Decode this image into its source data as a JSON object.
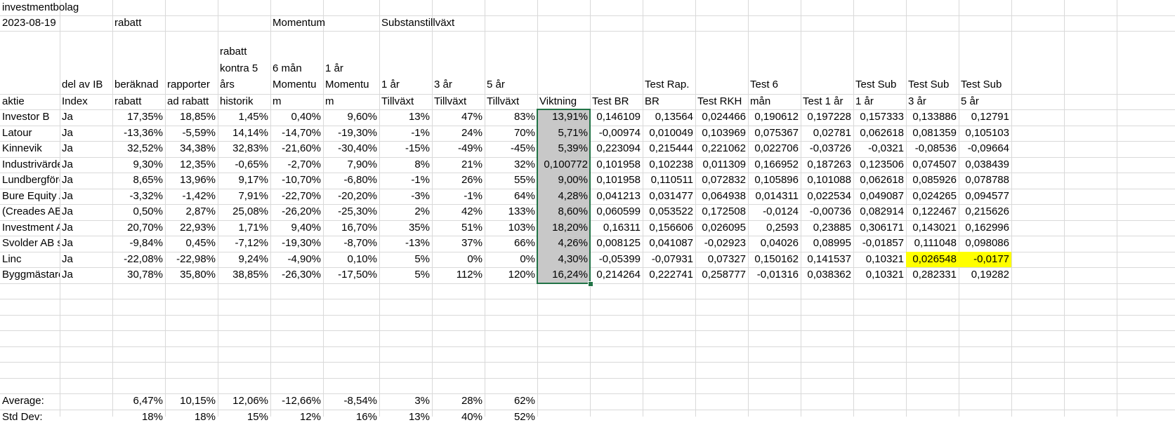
{
  "sheet": {
    "title": "investmentbolag",
    "date": "2023-08-19",
    "groups": [
      "rabatt",
      "Momentum",
      "Substanstillväxt"
    ],
    "headers": [
      [
        "aktie"
      ],
      [
        "del av IB",
        "Index"
      ],
      [
        "beräknad",
        "rabatt"
      ],
      [
        "rapporter",
        "ad rabatt"
      ],
      [
        "rabatt",
        "kontra 5",
        "års",
        "historik"
      ],
      [
        "6 mån",
        "Momentu",
        "m"
      ],
      [
        "1 år",
        "Momentu",
        "m"
      ],
      [
        "1 år",
        "Tillväxt"
      ],
      [
        "3 år",
        "Tillväxt"
      ],
      [
        "5 år",
        "Tillväxt"
      ],
      [
        "Viktning"
      ],
      [
        "Test BR"
      ],
      [
        "Test Rap.",
        "BR"
      ],
      [
        "Test RKH"
      ],
      [
        "Test 6",
        "mån"
      ],
      [
        "Test 1 år"
      ],
      [
        "Test Sub",
        "1 år"
      ],
      [
        "Test Sub",
        "3 år"
      ],
      [
        "Test Sub",
        "5 år"
      ]
    ],
    "rows": [
      [
        "Investor  B",
        "Ja",
        "17,35%",
        "18,85%",
        "1,45%",
        "0,40%",
        "9,60%",
        "13%",
        "47%",
        "83%",
        "13,91%",
        "0,146109",
        "0,13564",
        "0,024466",
        "0,190612",
        "0,197228",
        "0,157333",
        "0,133886",
        "0,12791"
      ],
      [
        "Latour",
        "Ja",
        "-13,36%",
        "-5,59%",
        "14,14%",
        "-14,70%",
        "-19,30%",
        "-1%",
        "24%",
        "70%",
        "5,71%",
        "-0,00974",
        "0,010049",
        "0,103969",
        "0,075367",
        "0,02781",
        "0,062618",
        "0,081359",
        "0,105103"
      ],
      [
        "Kinnevik",
        "Ja",
        "32,52%",
        "34,38%",
        "32,83%",
        "-21,60%",
        "-30,40%",
        "-15%",
        "-49%",
        "-45%",
        "5,39%",
        "0,223094",
        "0,215444",
        "0,221062",
        "0,022706",
        "-0,03726",
        "-0,0321",
        "-0,08536",
        "-0,09664"
      ],
      [
        "Industrivärden",
        "Ja",
        "9,30%",
        "12,35%",
        "-0,65%",
        "-2,70%",
        "7,90%",
        "8%",
        "21%",
        "32%",
        "0,100772",
        "0,101958",
        "0,102238",
        "0,011309",
        "0,166952",
        "0,187263",
        "0,123506",
        "0,074507",
        "0,038439"
      ],
      [
        "Lundbergföretagen",
        "Ja",
        "8,65%",
        "13,96%",
        "9,17%",
        "-10,70%",
        "-6,80%",
        "-1%",
        "26%",
        "55%",
        "9,00%",
        "0,101958",
        "0,110511",
        "0,072832",
        "0,105896",
        "0,101088",
        "0,062618",
        "0,085926",
        "0,078788"
      ],
      [
        "Bure Equity AB",
        "Ja",
        "-3,32%",
        "-1,42%",
        "7,91%",
        "-22,70%",
        "-20,20%",
        "-3%",
        "-1%",
        "64%",
        "4,28%",
        "0,041213",
        "0,031477",
        "0,064938",
        "0,014311",
        "0,022534",
        "0,049087",
        "0,024265",
        "0,094577"
      ],
      [
        "(Creades AB",
        "Ja",
        "0,50%",
        "2,87%",
        "25,08%",
        "-26,20%",
        "-25,30%",
        "2%",
        "42%",
        "133%",
        "8,60%",
        "0,060599",
        "0,053522",
        "0,172508",
        "-0,0124",
        "-0,00736",
        "0,082914",
        "0,122467",
        "0,215626"
      ],
      [
        "Investment AB",
        "Ja",
        "20,70%",
        "22,93%",
        "1,71%",
        "9,40%",
        "16,70%",
        "35%",
        "51%",
        "103%",
        "18,20%",
        "0,16311",
        "0,156606",
        "0,026095",
        "0,2593",
        "0,23885",
        "0,306171",
        "0,143021",
        "0,162996"
      ],
      [
        "Svolder AB ser",
        "Ja",
        "-9,84%",
        "0,45%",
        "-7,12%",
        "-19,30%",
        "-8,70%",
        "-13%",
        "37%",
        "66%",
        "4,26%",
        "0,008125",
        "0,041087",
        "-0,02923",
        "0,04026",
        "0,08995",
        "-0,01857",
        "0,111048",
        "0,098086"
      ],
      [
        "Linc",
        "Ja",
        "-22,08%",
        "-22,98%",
        "9,24%",
        "-4,90%",
        "0,10%",
        "5%",
        "0%",
        "0%",
        "4,30%",
        "-0,05399",
        "-0,07931",
        "0,07327",
        "0,150162",
        "0,141537",
        "0,10321",
        "0,026548",
        "-0,0177"
      ],
      [
        "Byggmästarens",
        "Ja",
        "30,78%",
        "35,80%",
        "38,85%",
        "-26,30%",
        "-17,50%",
        "5%",
        "112%",
        "120%",
        "16,24%",
        "0,214264",
        "0,222741",
        "0,258777",
        "-0,01316",
        "0,038362",
        "0,10321",
        "0,282331",
        "0,19282"
      ]
    ],
    "average": {
      "label": "Average:",
      "values": [
        "6,47%",
        "10,15%",
        "12,06%",
        "-12,66%",
        "-8,54%",
        "3%",
        "28%",
        "62%"
      ]
    },
    "stddev": {
      "label": "Std Dev:",
      "values": [
        "18%",
        "18%",
        "15%",
        "12%",
        "16%",
        "13%",
        "40%",
        "52%"
      ]
    },
    "colors": {
      "selection_border": "#217346",
      "selection_fill": "#c8c8c8",
      "highlight": "#ffff00",
      "grid": "#d9d9d9"
    }
  }
}
